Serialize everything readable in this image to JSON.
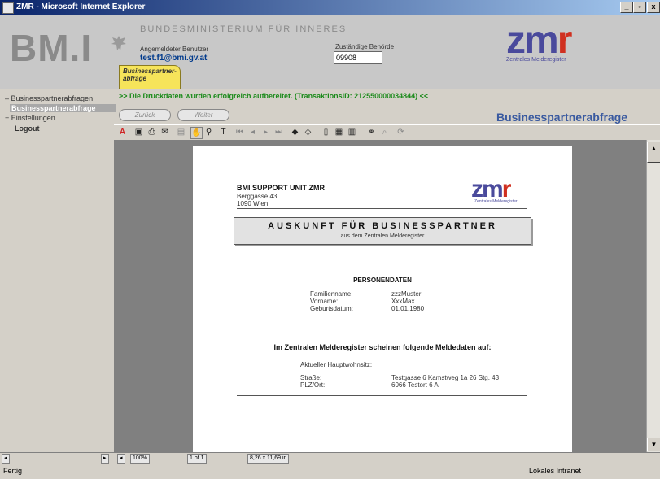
{
  "window": {
    "title": "ZMR - Microsoft Internet Explorer",
    "min": "_",
    "max": "▫",
    "close": "x"
  },
  "header": {
    "logo": "BM.I",
    "ministry": "BUNDESMINISTERIUM FÜR INNERES",
    "user_label": "Angemeldeter Benutzer",
    "user_email": "test.f1@bmi.gv.at",
    "authority_label": "Zuständige Behörde",
    "authority_value": "09908",
    "zmr_logo_main": "zm",
    "zmr_logo_r": "r",
    "zmr_sub": "Zentrales Melderegister",
    "tab_label": "Businesspartner-abfrage"
  },
  "nav": {
    "items": [
      {
        "label": "– Businesspartnerabfragen"
      },
      {
        "label": "Businesspartnerabfrage"
      },
      {
        "label": "+ Einstellungen"
      },
      {
        "label": "Logout"
      }
    ]
  },
  "main": {
    "message": ">> Die Druckdaten wurden erfolgreich aufbereitet. (TransaktionsID: 212550000034844) <<",
    "back_label": "Zurück",
    "next_label": "Weiter",
    "heading": "Businesspartnerabfrage"
  },
  "toolbar": {
    "icons": [
      "acrobat-icon",
      "save-icon",
      "print-icon",
      "email-icon",
      "thumbnails-icon",
      "hand-icon",
      "zoom-icon",
      "text-select-icon",
      "first-page-icon",
      "prev-page-icon",
      "next-page-icon",
      "last-page-icon",
      "back-icon",
      "forward-icon",
      "actual-size-icon",
      "fit-page-icon",
      "fit-width-icon",
      "find-icon",
      "web-search-icon",
      "rotate-icon"
    ]
  },
  "bottombar": {
    "zoom": "100%",
    "page": "1 of 1",
    "size": "8,26 x 11,69 in"
  },
  "status": {
    "left": "Fertig",
    "zone": "Lokales Intranet"
  },
  "document": {
    "org": "BMI SUPPORT UNIT ZMR",
    "addr1": "Berggasse 43",
    "addr2": "1090 Wien",
    "zmr_main": "zm",
    "zmr_r": "r",
    "zmr_sub": "Zentrales Melderegister",
    "box_title": "AUSKUNFT FÜR BUSINESSPARTNER",
    "box_sub": "aus dem Zentralen Melderegister",
    "section": "PERSONENDATEN",
    "person": [
      {
        "k": "Familienname:",
        "v": "zzzMuster"
      },
      {
        "k": "Vorname:",
        "v": "XxxMax"
      },
      {
        "k": "Geburtsdatum:",
        "v": "01.01.1980"
      }
    ],
    "melde_title": "Im Zentralen Melderegister scheinen folgende Meldedaten auf:",
    "hauptwohnsitz": "Aktueller Hauptwohnsitz:",
    "address": [
      {
        "k": "Straße:",
        "v": "Testgasse 6 Kamstweg 1a 26 Stg. 43"
      },
      {
        "k": "PLZ/Ort:",
        "v": "6066 Testort 6 A"
      }
    ]
  },
  "colors": {
    "accent": "#3a5aa0",
    "success": "#1a8a1a",
    "tab": "#f6e45a"
  }
}
